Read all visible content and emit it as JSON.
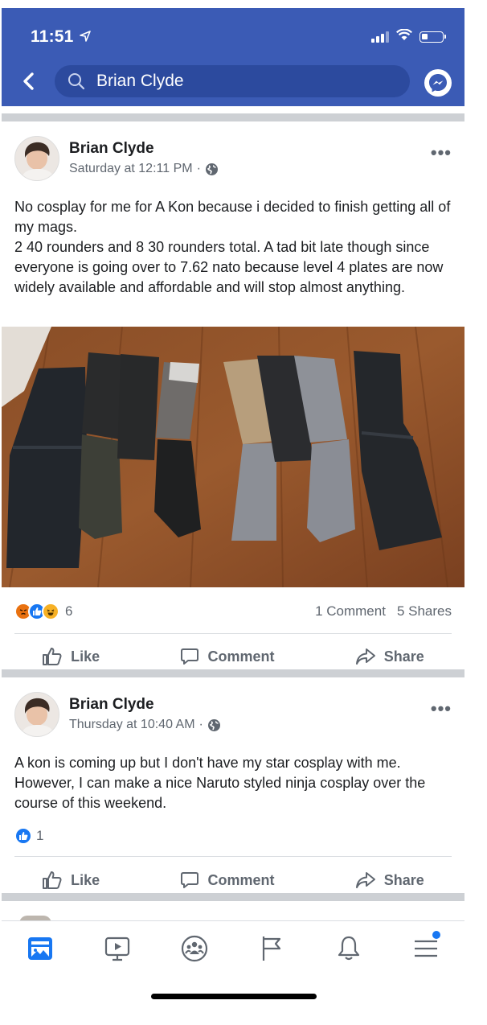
{
  "status_bar": {
    "time": "11:51",
    "location_arrow": "location-arrow-icon"
  },
  "search": {
    "query": "Brian Clyde"
  },
  "posts": [
    {
      "author": "Brian Clyde",
      "timestamp": "Saturday at 12:11 PM",
      "separator": "·",
      "audience_icon": "globe-icon",
      "text": "No cosplay for me for A Kon because i decided to finish getting all of my mags.\n2 40 rounders and 8 30 rounders total. A tad bit late though since everyone is going over to 7.62 nato because level 4 plates are now widely available and affordable and will stop almost anything.",
      "photo": "magazines-and-pouches-photo",
      "reactions": [
        "angry",
        "like",
        "haha"
      ],
      "reaction_count": "6",
      "comments": "1 Comment",
      "shares": "5 Shares"
    },
    {
      "author": "Brian Clyde",
      "timestamp": "Thursday at 10:40 AM",
      "separator": "·",
      "audience_icon": "globe-icon",
      "text": "A kon is coming up but I don't have my star cosplay with me. However, I can make a nice Naruto styled ninja cosplay over the course of this weekend.",
      "reactions": [
        "like"
      ],
      "reaction_count": "1"
    }
  ],
  "actions": {
    "like": "Like",
    "comment": "Comment",
    "share": "Share"
  },
  "more_label": "•••",
  "tabbar": {
    "items": [
      "news-feed-icon",
      "watch-icon",
      "groups-icon",
      "pages-flag-icon",
      "notifications-bell-icon",
      "menu-icon"
    ],
    "menu_badge": true
  },
  "colors": {
    "header": "#3b5bb5",
    "like_blue": "#1877f2",
    "angry": "#e9710f",
    "haha": "#f7b125"
  }
}
